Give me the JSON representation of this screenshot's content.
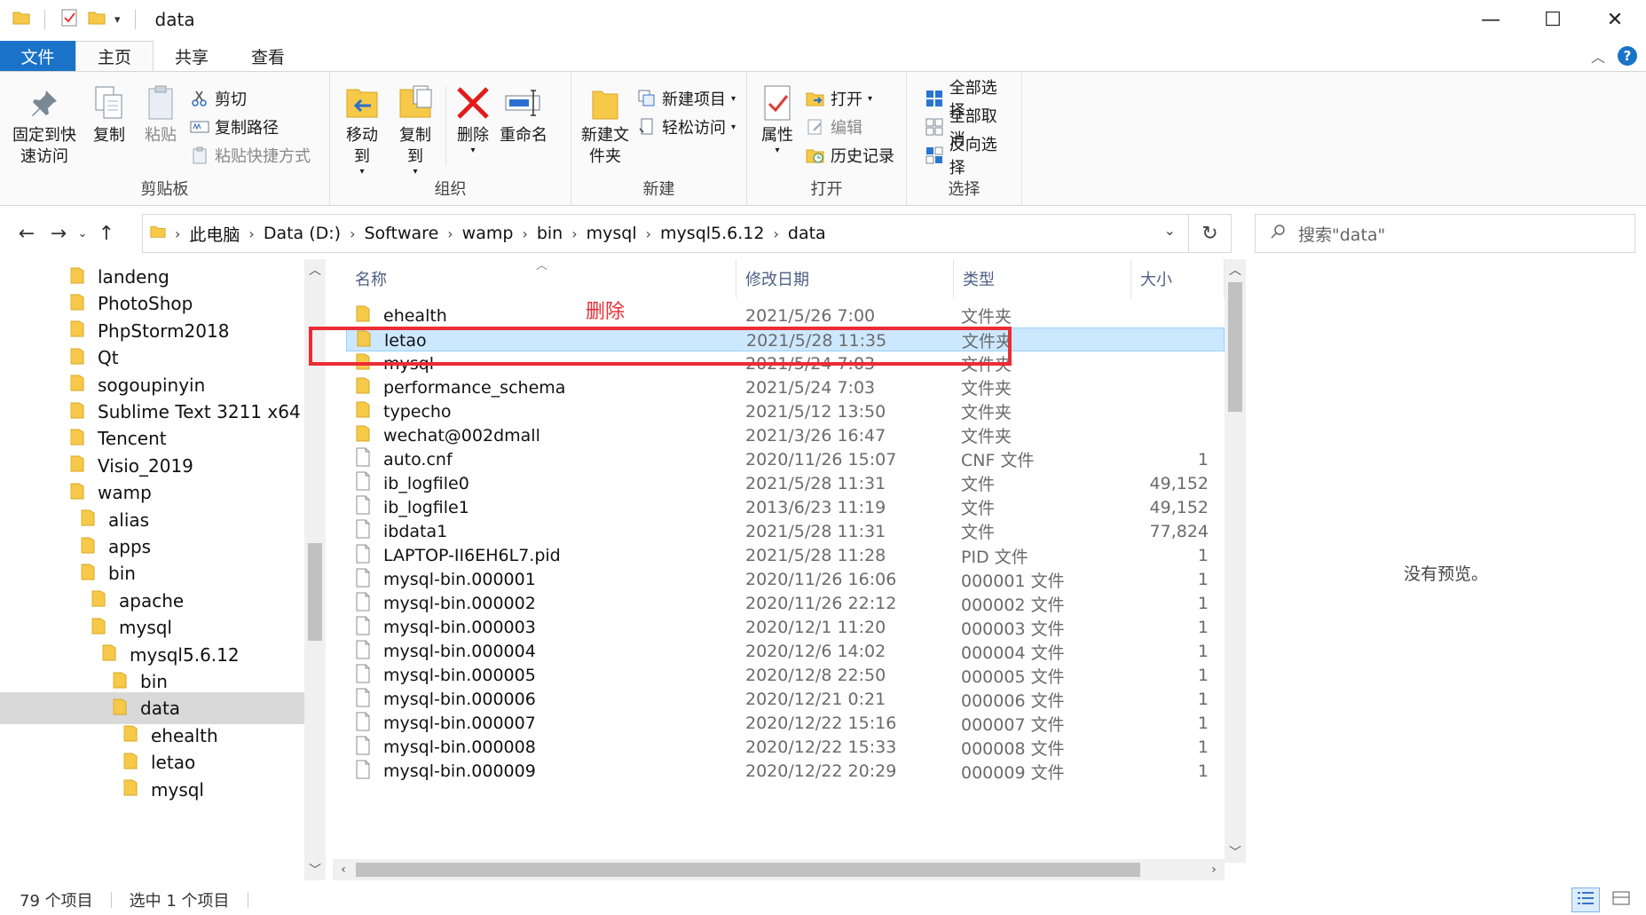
{
  "window": {
    "title": "data",
    "minimize": "—",
    "maximize": "☐",
    "close": "✕"
  },
  "tabs": [
    {
      "label": "文件",
      "state": "file"
    },
    {
      "label": "主页",
      "state": "active"
    },
    {
      "label": "共享",
      "state": ""
    },
    {
      "label": "查看",
      "state": ""
    }
  ],
  "ribbon": {
    "clipboard": {
      "label": "剪贴板",
      "pin_quick_access": "固定到快速访问",
      "copy": "复制",
      "paste": "粘贴",
      "cut": "剪切",
      "copy_path": "复制路径",
      "paste_shortcut": "粘贴快捷方式"
    },
    "organize": {
      "label": "组织",
      "move_to": "移动到",
      "copy_to": "复制到",
      "delete": "删除",
      "rename": "重命名"
    },
    "new": {
      "label": "新建",
      "new_folder": "新建文件夹",
      "new_item": "新建项目",
      "easy_access": "轻松访问"
    },
    "open": {
      "label": "打开",
      "properties": "属性",
      "open": "打开",
      "edit": "编辑",
      "history": "历史记录"
    },
    "select": {
      "label": "选择",
      "select_all": "全部选择",
      "select_none": "全部取消",
      "invert": "反向选择"
    }
  },
  "address": {
    "crumbs": [
      "此电脑",
      "Data (D:)",
      "Software",
      "wamp",
      "bin",
      "mysql",
      "mysql5.6.12",
      "data"
    ]
  },
  "search": {
    "placeholder": "搜索\"data\""
  },
  "tree": [
    {
      "label": "landeng",
      "indent": 0
    },
    {
      "label": "PhotoShop",
      "indent": 0
    },
    {
      "label": "PhpStorm2018",
      "indent": 0
    },
    {
      "label": "Qt",
      "indent": 0
    },
    {
      "label": "sogoupinyin",
      "indent": 0
    },
    {
      "label": "Sublime Text 3211 x64",
      "indent": 0
    },
    {
      "label": "Tencent",
      "indent": 0
    },
    {
      "label": "Visio_2019",
      "indent": 0
    },
    {
      "label": "wamp",
      "indent": 0
    },
    {
      "label": "alias",
      "indent": 1
    },
    {
      "label": "apps",
      "indent": 1
    },
    {
      "label": "bin",
      "indent": 1
    },
    {
      "label": "apache",
      "indent": 2
    },
    {
      "label": "mysql",
      "indent": 2
    },
    {
      "label": "mysql5.6.12",
      "indent": 3
    },
    {
      "label": "bin",
      "indent": 4
    },
    {
      "label": "data",
      "indent": 4,
      "selected": true
    },
    {
      "label": "ehealth",
      "indent": 5
    },
    {
      "label": "letao",
      "indent": 5
    },
    {
      "label": "mysql",
      "indent": 5
    }
  ],
  "columns": {
    "name": "名称",
    "date": "修改日期",
    "type": "类型",
    "size": "大小"
  },
  "files": [
    {
      "name": "ehealth",
      "date": "2021/5/26 7:00",
      "type": "文件夹",
      "size": "",
      "kind": "folder"
    },
    {
      "name": "letao",
      "date": "2021/5/28 11:35",
      "type": "文件夹",
      "size": "",
      "kind": "folder",
      "selected": true
    },
    {
      "name": "mysql",
      "date": "2021/5/24 7:03",
      "type": "文件夹",
      "size": "",
      "kind": "folder"
    },
    {
      "name": "performance_schema",
      "date": "2021/5/24 7:03",
      "type": "文件夹",
      "size": "",
      "kind": "folder"
    },
    {
      "name": "typecho",
      "date": "2021/5/12 13:50",
      "type": "文件夹",
      "size": "",
      "kind": "folder"
    },
    {
      "name": "wechat@002dmall",
      "date": "2021/3/26 16:47",
      "type": "文件夹",
      "size": "",
      "kind": "folder"
    },
    {
      "name": "auto.cnf",
      "date": "2020/11/26 15:07",
      "type": "CNF 文件",
      "size": "1",
      "kind": "file"
    },
    {
      "name": "ib_logfile0",
      "date": "2021/5/28 11:31",
      "type": "文件",
      "size": "49,152",
      "kind": "file"
    },
    {
      "name": "ib_logfile1",
      "date": "2013/6/23 11:19",
      "type": "文件",
      "size": "49,152",
      "kind": "file"
    },
    {
      "name": "ibdata1",
      "date": "2021/5/28 11:31",
      "type": "文件",
      "size": "77,824",
      "kind": "file"
    },
    {
      "name": "LAPTOP-II6EH6L7.pid",
      "date": "2021/5/28 11:28",
      "type": "PID 文件",
      "size": "1",
      "kind": "file"
    },
    {
      "name": "mysql-bin.000001",
      "date": "2020/11/26 16:06",
      "type": "000001 文件",
      "size": "1",
      "kind": "file"
    },
    {
      "name": "mysql-bin.000002",
      "date": "2020/11/26 22:12",
      "type": "000002 文件",
      "size": "1",
      "kind": "file"
    },
    {
      "name": "mysql-bin.000003",
      "date": "2020/12/1 11:20",
      "type": "000003 文件",
      "size": "1",
      "kind": "file"
    },
    {
      "name": "mysql-bin.000004",
      "date": "2020/12/6 14:02",
      "type": "000004 文件",
      "size": "1",
      "kind": "file"
    },
    {
      "name": "mysql-bin.000005",
      "date": "2020/12/8 22:50",
      "type": "000005 文件",
      "size": "1",
      "kind": "file"
    },
    {
      "name": "mysql-bin.000006",
      "date": "2020/12/21 0:21",
      "type": "000006 文件",
      "size": "1",
      "kind": "file"
    },
    {
      "name": "mysql-bin.000007",
      "date": "2020/12/22 15:16",
      "type": "000007 文件",
      "size": "1",
      "kind": "file"
    },
    {
      "name": "mysql-bin.000008",
      "date": "2020/12/22 15:33",
      "type": "000008 文件",
      "size": "1",
      "kind": "file"
    },
    {
      "name": "mysql-bin.000009",
      "date": "2020/12/22 20:29",
      "type": "000009 文件",
      "size": "1",
      "kind": "file"
    }
  ],
  "annotation": {
    "label": "删除",
    "color": "#ec2b34"
  },
  "preview": {
    "text": "没有预览。"
  },
  "status": {
    "item_count": "79 个项目",
    "selected": "选中 1 个项目"
  },
  "colors": {
    "accent": "#1a73c8",
    "selection": "#cce8ff",
    "folder": "#f7c948"
  }
}
